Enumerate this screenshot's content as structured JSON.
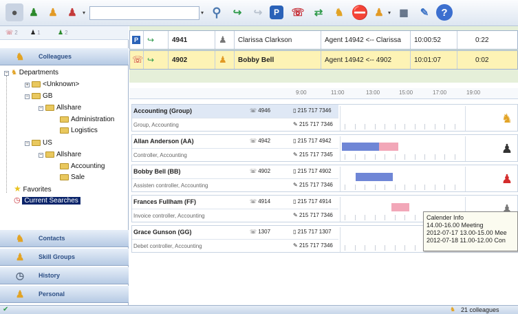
{
  "toolbar": {
    "search_placeholder": "",
    "buttons": [
      "status-available",
      "status-user-green",
      "status-user-orange",
      "status-user-red",
      "search",
      "transfer",
      "transfer-disabled",
      "park",
      "hangup",
      "conference",
      "colleagues-group",
      "do-not-disturb",
      "agent",
      "grid-view",
      "notes",
      "help"
    ]
  },
  "status_counts": [
    {
      "icon": "phone-red-icon",
      "count": "2"
    },
    {
      "icon": "agent-black-icon",
      "count": "1"
    },
    {
      "icon": "agent-green-icon",
      "count": "2"
    }
  ],
  "left": {
    "colleagues_label": "Colleagues",
    "tree": {
      "departments": "Departments",
      "unknown": "<Unknown>",
      "gb": "GB",
      "gb_allshare": "Allshare",
      "administration": "Administration",
      "logistics": "Logistics",
      "us": "US",
      "us_allshare": "Allshare",
      "accounting": "Accounting",
      "sale": "Sale",
      "favorites": "Favorites",
      "current_searches": "Current Searches"
    },
    "nav": [
      {
        "label": "Contacts"
      },
      {
        "label": "Skill Groups"
      },
      {
        "label": "History"
      },
      {
        "label": "Personal"
      }
    ]
  },
  "calls": [
    {
      "ext": "4941",
      "name": "Clarissa Clarkson",
      "route": "Agent 14942 <-- Clarissa",
      "time": "10:00:52",
      "duration": "0:22"
    },
    {
      "ext": "4902",
      "name": "Bobby Bell",
      "route": "Agent 14942 <-- 4902",
      "time": "10:01:07",
      "duration": "0:02"
    }
  ],
  "timeline": [
    "9:00",
    "11:00",
    "13:00",
    "15:00",
    "17:00",
    "19:00"
  ],
  "contacts": [
    {
      "name": "Accounting (Group)",
      "sub": "Group, Accounting",
      "ext": "4946",
      "phone1": "215 717 7346",
      "phone2": "215 717 7346"
    },
    {
      "name": "Allan Anderson (AA)",
      "sub": "Controller, Accounting",
      "ext": "4942",
      "phone1": "215 717 4942",
      "phone2": "215 717 7345"
    },
    {
      "name": "Bobby Bell (BB)",
      "sub": "Assisten controller, Accounting",
      "ext": "4902",
      "phone1": "215 717 4902",
      "phone2": "215 717 7346"
    },
    {
      "name": "Frances Fullham (FF)",
      "sub": "Invoice controller, Accounting",
      "ext": "4914",
      "phone1": "215 717 4914",
      "phone2": "215 717 7346"
    },
    {
      "name": "Grace Gunson (GG)",
      "sub": "Debet controller, Accounting",
      "ext": "1307",
      "phone1": "215 717 1307",
      "phone2": "215 717 7346"
    }
  ],
  "tooltip": {
    "title": "Calender Info",
    "line1": "14.00-16.00  Meeting",
    "line2": "2012-07-17 13.00-15.00 Mee",
    "line3": "2012-07-18 11.00-12.00 Con"
  },
  "statusbar": {
    "colleagues": "21 colleagues"
  },
  "colors": {
    "accent": "#2d4f85",
    "call_active": "#e5efd9",
    "ringing_row": "#fdf3b5",
    "busy_bar": "#6f86d6",
    "meeting_bar": "#f2a7b8"
  }
}
